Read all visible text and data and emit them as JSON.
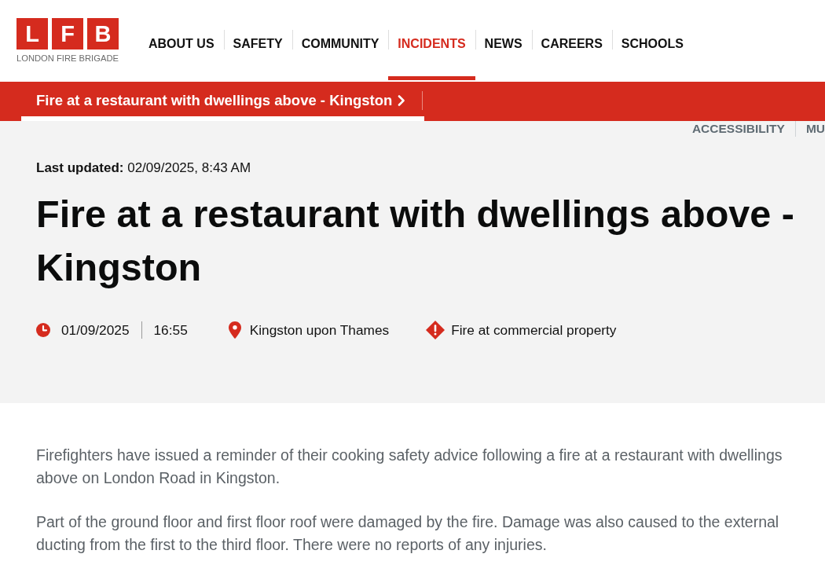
{
  "header": {
    "logo": {
      "letters": [
        "L",
        "F",
        "B"
      ],
      "caption": "LONDON FIRE BRIGADE"
    },
    "nav": [
      {
        "label": "ABOUT US",
        "selected": false
      },
      {
        "label": "SAFETY",
        "selected": false
      },
      {
        "label": "COMMUNITY",
        "selected": false
      },
      {
        "label": "INCIDENTS",
        "selected": true
      },
      {
        "label": "NEWS",
        "selected": false
      },
      {
        "label": "CAREERS",
        "selected": false
      },
      {
        "label": "SCHOOLS",
        "selected": false
      }
    ]
  },
  "breadcrumb": {
    "label": "Fire at a restaurant with dwellings above - Kingston"
  },
  "utility_links": [
    "ACCESSIBILITY",
    "MU"
  ],
  "incident": {
    "last_updated": "**Last updated:** 02/09/2025, 8:43 AM",
    "title": "Fire at a restaurant with dwellings above - Kingston",
    "meta": [
      {
        "kind": "date",
        "text": "01/09/2025"
      },
      {
        "kind": "time",
        "text": "16:55"
      },
      {
        "kind": "location",
        "text": "Kingston upon Thames"
      },
      {
        "kind": "incident_type",
        "text": "Fire at commercial property"
      }
    ]
  },
  "body": {
    "paragraphs": [
      "Firefighters have issued a reminder of their cooking safety advice following a fire at a restaurant with dwellings above on London Road in Kingston.",
      "Part of the ground floor and first floor roof were damaged by the fire. Damage was also caused to the external ducting from the first to the third floor. There were no reports of any injuries."
    ]
  }
}
